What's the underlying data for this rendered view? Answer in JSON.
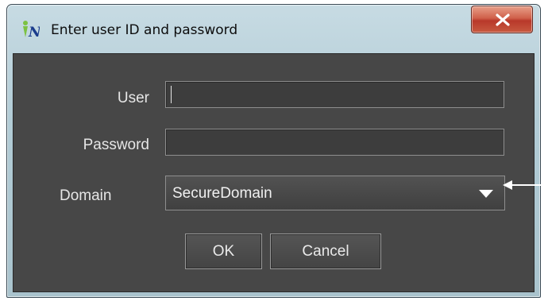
{
  "window": {
    "title": "Enter user ID and password",
    "app_icon": "app-logo-icon",
    "close_icon": "close-icon"
  },
  "form": {
    "user_label": "User",
    "user_value": "",
    "password_label": "Password",
    "password_value": "",
    "domain_label": "Domain",
    "domain_selected": "SecureDomain",
    "domain_arrow_icon": "chevron-down-icon"
  },
  "buttons": {
    "ok_label": "OK",
    "cancel_label": "Cancel"
  },
  "annotation": {
    "pointer_icon": "callout-arrow-icon"
  }
}
